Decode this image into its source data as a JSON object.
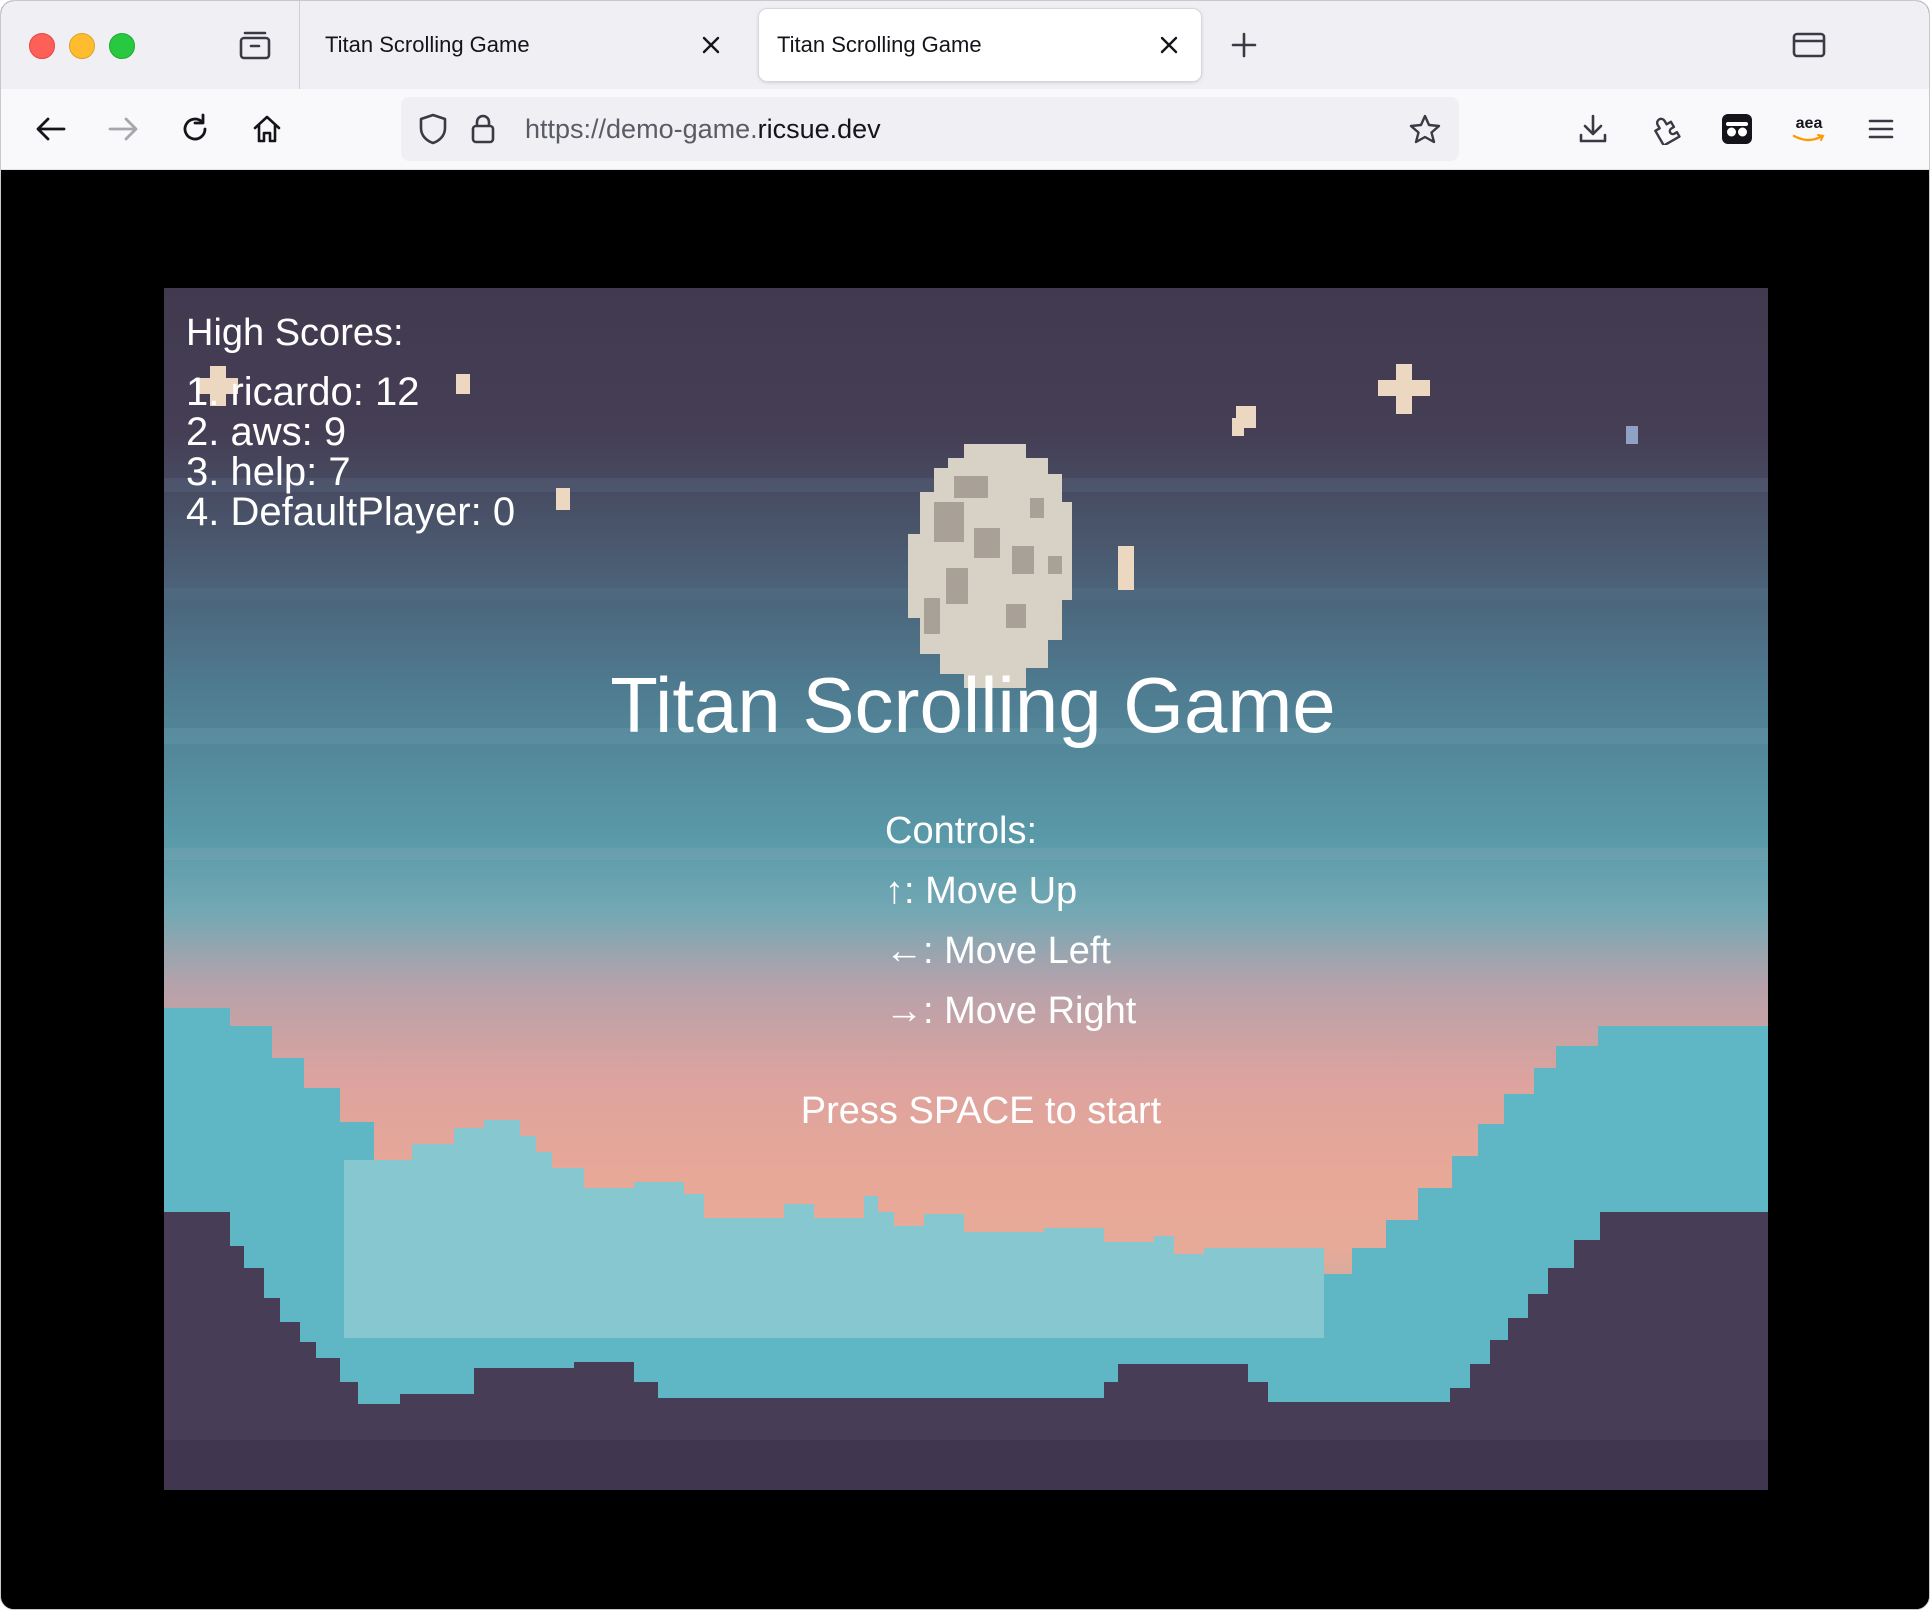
{
  "browser": {
    "tabs": [
      {
        "title": "Titan Scrolling Game",
        "active": false
      },
      {
        "title": "Titan Scrolling Game",
        "active": true
      }
    ],
    "url": {
      "prefix": "https://demo-game.",
      "host": "ricsue.dev"
    },
    "extension_label": "aea",
    "icons": [
      "tab-groups-icon",
      "close-icon",
      "new-tab-icon",
      "window-icon",
      "back-icon",
      "forward-icon",
      "reload-icon",
      "home-icon",
      "shield-icon",
      "lock-icon",
      "bookmark-star-icon",
      "download-icon",
      "extensions-icon",
      "incognito-icon",
      "amazon-icon",
      "menu-icon"
    ]
  },
  "game": {
    "high_scores_title": "High Scores:",
    "high_scores": [
      "1. ricardo: 12",
      "2. aws: 9",
      "3. help: 7",
      "4. DefaultPlayer: 0"
    ],
    "title": "Titan Scrolling Game",
    "controls_title": "Controls:",
    "controls": [
      "↑: Move Up",
      "←: Move Left",
      "→: Move Right"
    ],
    "start_prompt": "Press SPACE to start"
  }
}
